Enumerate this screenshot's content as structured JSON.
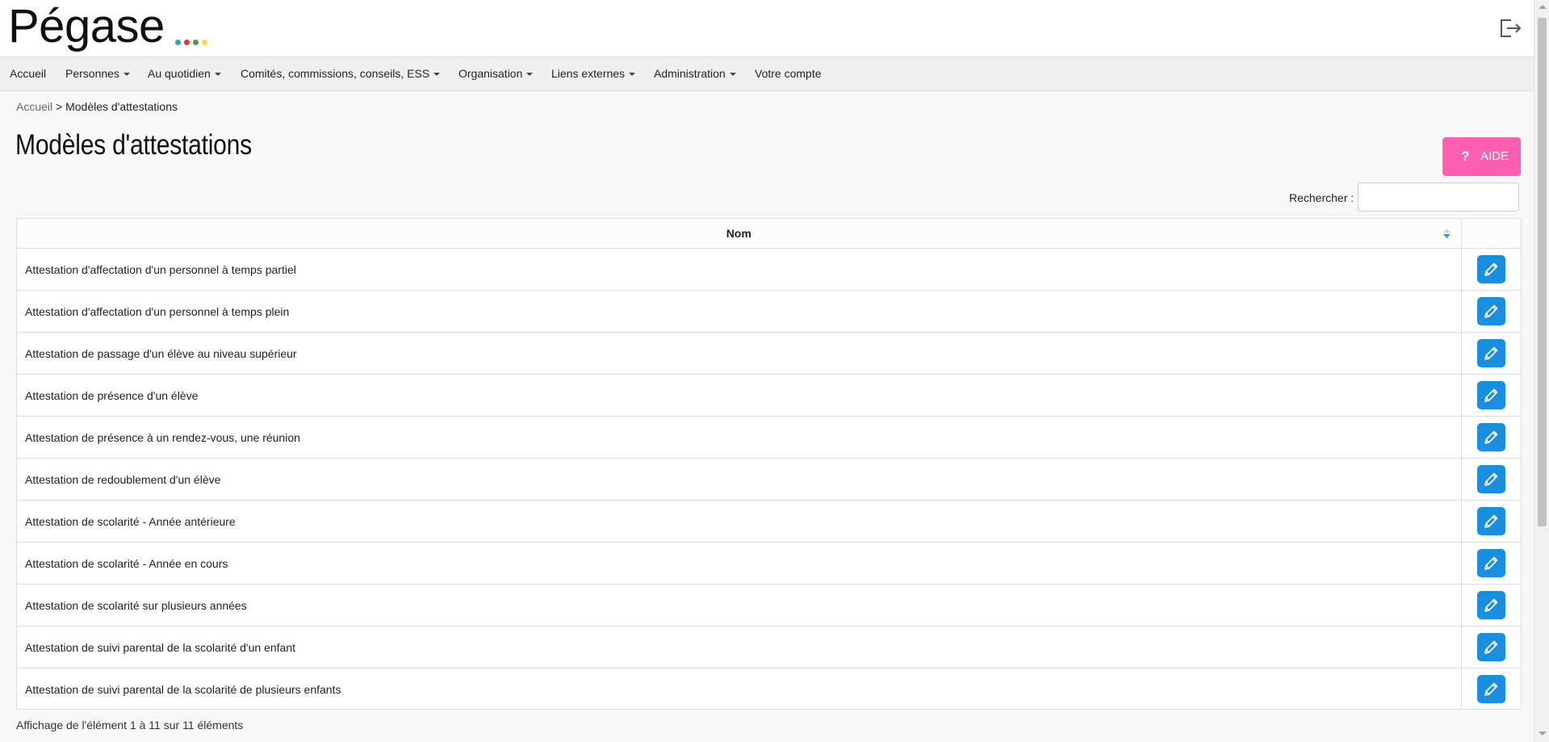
{
  "app": {
    "logo_text": "Pégase",
    "logo_dot_colors": [
      "#2aa5d8",
      "#e53935",
      "#43a047",
      "#fdd835"
    ],
    "logout_icon": "logout-icon"
  },
  "nav": {
    "items": [
      {
        "label": "Accueil",
        "dropdown": false
      },
      {
        "label": "Personnes",
        "dropdown": true
      },
      {
        "label": "Au quotidien",
        "dropdown": true
      },
      {
        "label": "Comités, commissions, conseils, ESS",
        "dropdown": true
      },
      {
        "label": "Organisation",
        "dropdown": true
      },
      {
        "label": "Liens externes",
        "dropdown": true
      },
      {
        "label": "Administration",
        "dropdown": true
      },
      {
        "label": "Votre compte",
        "dropdown": false
      }
    ]
  },
  "breadcrumb": {
    "home": "Accueil",
    "separator": ">",
    "current": "Modèles d'attestations"
  },
  "page": {
    "title": "Modèles d'attestations",
    "help_button": {
      "icon": "?",
      "label": "AIDE",
      "color": "#ff5fb0"
    }
  },
  "search": {
    "label": "Rechercher :",
    "value": ""
  },
  "table": {
    "column_name": "Nom",
    "edit_icon": "pencil-icon",
    "edit_color": "#1a8fe0",
    "rows": [
      "Attestation d'affectation d'un personnel à temps partiel",
      "Attestation d'affectation d'un personnel à temps plein",
      "Attestation de passage d'un élève au niveau supérieur",
      "Attestation de présence d'un élève",
      "Attestation de présence à un rendez-vous, une réunion",
      "Attestation de redoublement d'un élève",
      "Attestation de scolarité - Année antérieure",
      "Attestation de scolarité - Année en cours",
      "Attestation de scolarité sur plusieurs années",
      "Attestation de suivi parental de la scolarité d'un enfant",
      "Attestation de suivi parental de la scolarité de plusieurs enfants"
    ],
    "info": "Affichage de l'élément 1 à 11 sur 11 éléments"
  }
}
